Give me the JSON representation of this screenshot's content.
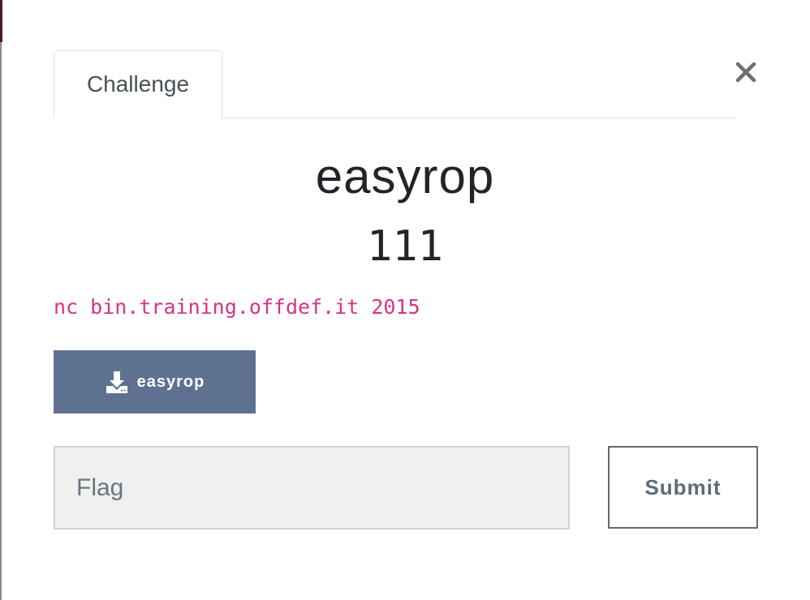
{
  "modal": {
    "tab_label": "Challenge",
    "close_icon": "close-icon",
    "challenge": {
      "name": "easyrop",
      "points": "111",
      "connection_info": "nc bin.training.offdef.it 2015"
    },
    "download": {
      "label": "easyrop",
      "icon": "download-icon"
    },
    "flag_form": {
      "placeholder": "Flag",
      "value": "",
      "submit_label": "Submit"
    }
  },
  "colors": {
    "download_button": "#5f7190",
    "connection_text": "#d63384",
    "submit_border": "#5f6b76",
    "input_background": "#f0f0f0"
  }
}
